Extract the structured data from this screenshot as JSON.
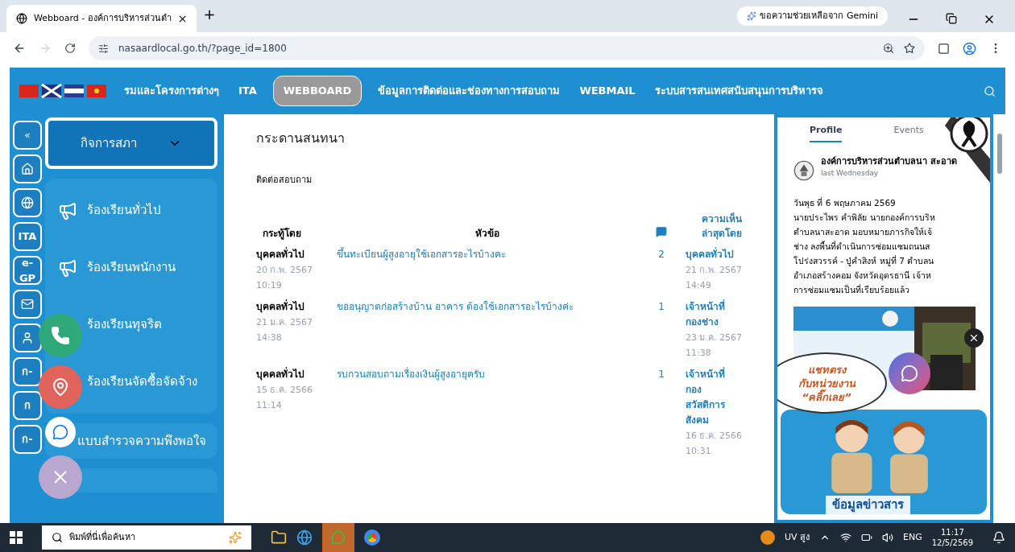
{
  "browser": {
    "tab_title": "Webboard - องค์การบริหารส่วนตำ",
    "tab_close": "×",
    "new_tab": "+",
    "gemini": "ขอความช่วยเหลือจาก Gemini",
    "url": "nasaardlocal.go.th/?page_id=1800"
  },
  "nav": {
    "items": [
      {
        "label": "รมและโครงการต่างๆ",
        "selected": false
      },
      {
        "label": "ITA",
        "selected": false
      },
      {
        "label": "WEBBOARD",
        "selected": true
      },
      {
        "label": "ข้อมูลการติดต่อและช่องทางการสอบถาม",
        "selected": false
      },
      {
        "label": "WEBMAIL",
        "selected": false
      },
      {
        "label": "ระบบสารสนเทศสนับสนุนการบริหารจ",
        "selected": false
      }
    ]
  },
  "side_icons": [
    {
      "kind": "collapse",
      "label": "«"
    },
    {
      "kind": "home"
    },
    {
      "kind": "globe"
    },
    {
      "kind": "text",
      "label": "ITA"
    },
    {
      "kind": "text",
      "label": "e-GP"
    },
    {
      "kind": "mail"
    },
    {
      "kind": "person"
    },
    {
      "kind": "text",
      "label": "ก-"
    },
    {
      "kind": "text",
      "label": "ก"
    },
    {
      "kind": "text",
      "label": "ก-"
    }
  ],
  "sidebar": {
    "header": "กิจการสภา",
    "complaints": [
      {
        "label": "ร้องเรียนทั่วไป",
        "icon": true
      },
      {
        "label": "ร้องเรียนพนักงาน",
        "icon": true
      },
      {
        "label": "ร้องเรียนทุจริต",
        "icon": false
      },
      {
        "label": "ร้องเรียนจัดซื้อจัดจ้าง",
        "icon": false
      }
    ],
    "survey": "แบบสำรวจความพึงพอใจ"
  },
  "board": {
    "title": "กระดานสนทนา",
    "subtitle": "ติดต่อสอบถาม",
    "columns": {
      "author": "กระทู้โดย",
      "topic": "หัวข้อ",
      "last": "ความเห็นล่าสุดโดย"
    },
    "rows": [
      {
        "author": "บุคคลทั่วไป",
        "date": "20 ก.พ. 2567",
        "time": "10:19",
        "topic": "ขึ้นทะเบียนผู้สูงอายุใช้เอกสารอะไรบ้างคะ",
        "replies": "2",
        "last_by": "บุคคลทั่วไป",
        "last_date": "21 ก.พ. 2567",
        "last_time": "14:49"
      },
      {
        "author": "บุคคลทั่วไป",
        "date": "21 ม.ค. 2567",
        "time": "14:38",
        "topic": "ขออนุญาตก่อสร้างบ้าน อาคาร ต้องใช้เอกสารอะไรบ้างค่ะ",
        "replies": "1",
        "last_by": "เจ้าหน้าที่ กองช่าง",
        "last_date": "23 ม.ค. 2567",
        "last_time": "11:38"
      },
      {
        "author": "บุคคลทั่วไป",
        "date": "15 ธ.ค. 2566",
        "time": "11:14",
        "topic": "รบกวนสอบถามเรื่องเงินผู้สูงอายุครับ",
        "replies": "1",
        "last_by": "เจ้าหน้าที่ กอง สวัสดิการ สังคม",
        "last_date": "16 ธ.ค. 2566",
        "last_time": "10:31"
      }
    ]
  },
  "feed": {
    "tabs": [
      {
        "label": "Profile",
        "selected": true
      },
      {
        "label": "Events",
        "selected": false
      }
    ],
    "page_name": "องค์การบริหารส่วนตำบลนา สะอาด",
    "when": "last Wednesday",
    "post_lines": [
      "วันพุธ ที่ 6 พฤษภาคม 2569",
      "นายประไพร คำพิลัย นายกองค์การบริห",
      "ตำบลนาสะอาด มอบหมายภารกิจให้เจ้",
      "ช่าง ลงพื้นที่ดำเนินการซ่อมแซมถนนส",
      "โปร่งสวรรค์ - ปู่คำสิงห์ หมู่ที่ 7 ตำบลน",
      "อำเภอสร้างคอม จังหวัดอุดรธานี เจ้าห",
      "การซ่อมแซมเป็นที่เรียบร้อยแล้ว"
    ],
    "chat_bubble": [
      "แชทตรง",
      "กับหน่วยงาน",
      "“คลิ๊กเลย”"
    ],
    "banner": "ข้อมูลข่าวสาร"
  },
  "taskbar": {
    "search": "พิมพ์ที่นี่เพื่อค้นหา",
    "weather": "UV สูง",
    "lang": "ENG",
    "time": "11:17",
    "date": "12/5/2569"
  }
}
